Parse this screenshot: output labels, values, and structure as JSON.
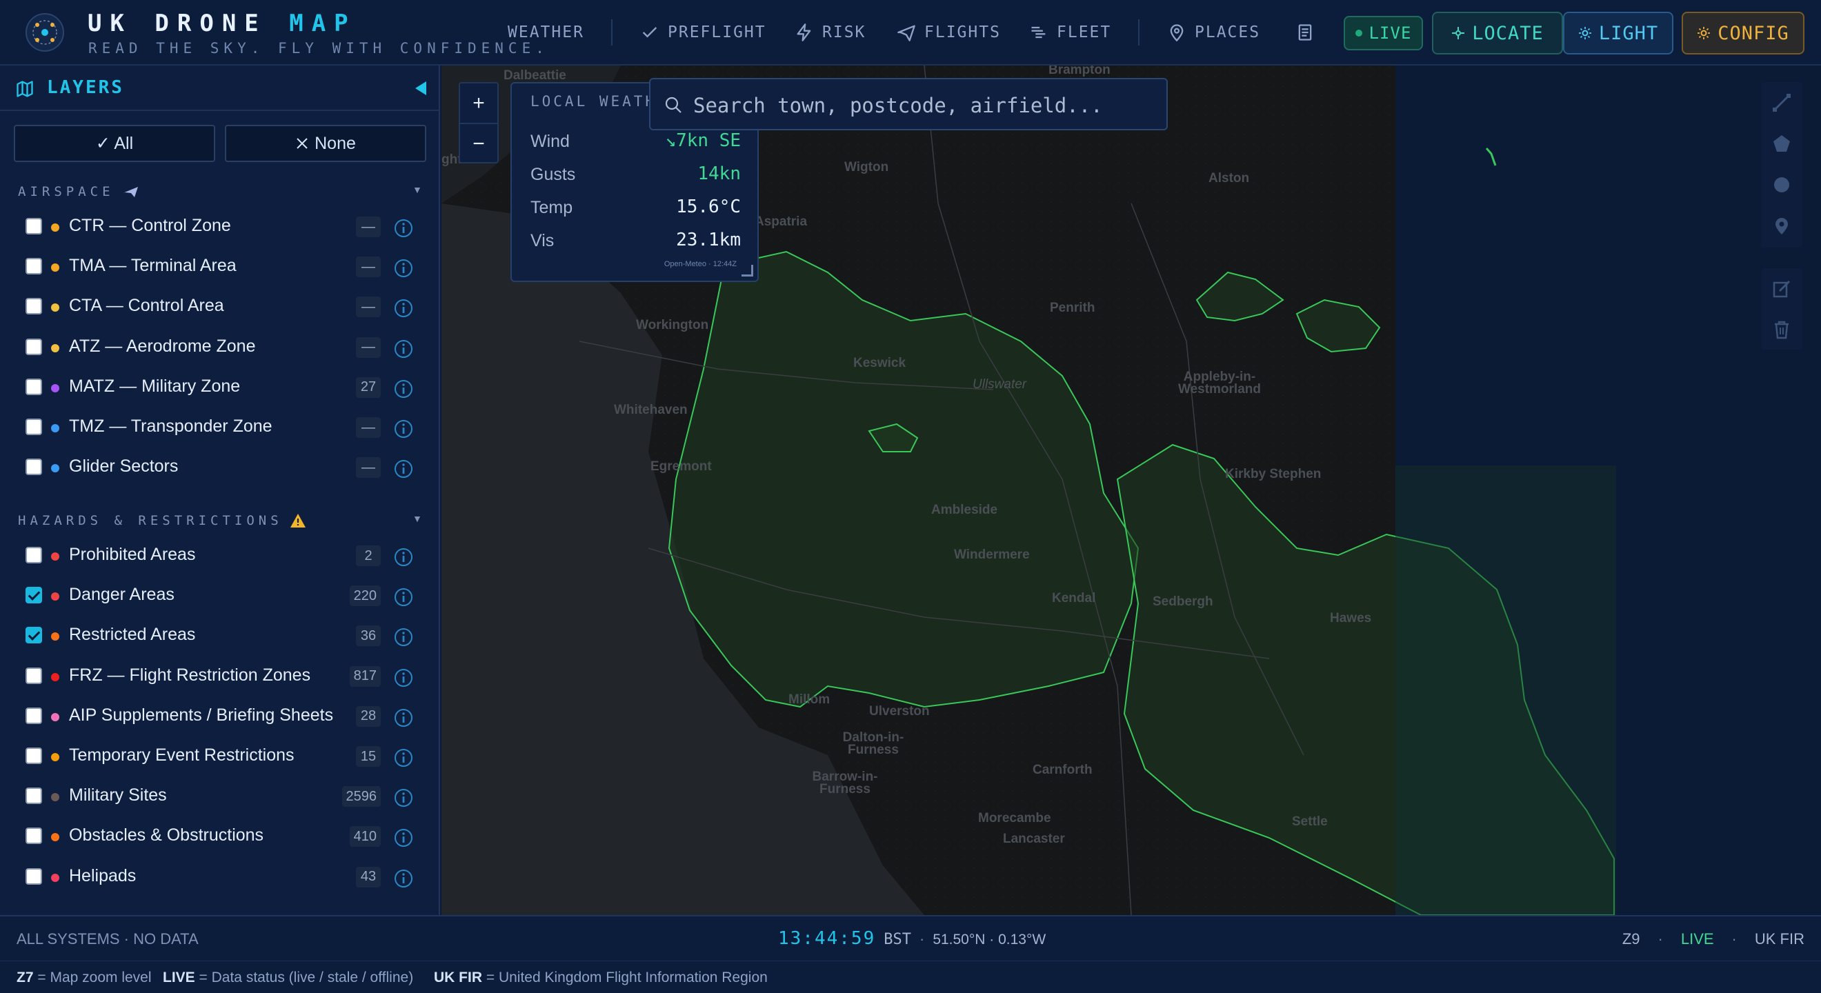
{
  "brand": {
    "title_main": "UK DRONE ",
    "title_accent": "MAP",
    "tagline": "READ THE SKY. FLY WITH CONFIDENCE."
  },
  "nav": [
    {
      "label": "WEATHER",
      "icon": "cloud-icon"
    },
    {
      "label": "PREFLIGHT",
      "icon": "check-icon"
    },
    {
      "label": "RISK",
      "icon": "lightning-icon"
    },
    {
      "label": "FLIGHTS",
      "icon": "plane-icon"
    },
    {
      "label": "FLEET",
      "icon": "drone-icon"
    },
    {
      "label": "PLACES",
      "icon": "pin-icon"
    }
  ],
  "topbar_buttons": {
    "live": "LIVE",
    "locate": "LOCATE",
    "light": "LIGHT",
    "config": "CONFIG"
  },
  "sidebar": {
    "title": "LAYERS",
    "all_label": "✓ All",
    "none_label": "None",
    "sections": [
      {
        "title": "AIRSPACE",
        "icon": "plane-icon",
        "layers": [
          {
            "name": "CTR — Control Zone",
            "color": "#f5a623",
            "count": "—",
            "checked": false
          },
          {
            "name": "TMA — Terminal Area",
            "color": "#f5a623",
            "count": "—",
            "checked": false
          },
          {
            "name": "CTA — Control Area",
            "color": "#f0c040",
            "count": "—",
            "checked": false
          },
          {
            "name": "ATZ — Aerodrome Zone",
            "color": "#f0c040",
            "count": "—",
            "checked": false
          },
          {
            "name": "MATZ — Military Zone",
            "color": "#a855f7",
            "count": "27",
            "checked": false
          },
          {
            "name": "TMZ — Transponder Zone",
            "color": "#3b9cf5",
            "count": "—",
            "checked": false
          },
          {
            "name": "Glider Sectors",
            "color": "#3b9cf5",
            "count": "—",
            "checked": false
          }
        ]
      },
      {
        "title": "HAZARDS & RESTRICTIONS",
        "icon": "warning-icon",
        "layers": [
          {
            "name": "Prohibited Areas",
            "color": "#ef4444",
            "count": "2",
            "checked": false
          },
          {
            "name": "Danger Areas",
            "color": "#ef4444",
            "count": "220",
            "checked": true
          },
          {
            "name": "Restricted Areas",
            "color": "#f97316",
            "count": "36",
            "checked": true
          },
          {
            "name": "FRZ — Flight Restriction Zones",
            "color": "#ef2020",
            "count": "817",
            "checked": false
          },
          {
            "name": "AIP Supplements / Briefing Sheets",
            "color": "#f472b6",
            "count": "28",
            "checked": false
          },
          {
            "name": "Temporary Event Restrictions",
            "color": "#f59e0b",
            "count": "15",
            "checked": false
          },
          {
            "name": "Military Sites",
            "color": "#6b5a55",
            "count": "2596",
            "checked": false
          },
          {
            "name": "Obstacles & Obstructions",
            "color": "#f97316",
            "count": "410",
            "checked": false
          },
          {
            "name": "Helipads",
            "color": "#f43f5e",
            "count": "43",
            "checked": false
          }
        ]
      }
    ]
  },
  "map": {
    "zoom_in": "+",
    "zoom_out": "−",
    "search_placeholder": "Search town, postcode, airfield...",
    "weather": {
      "title": "LOCAL WEATHER",
      "rows": [
        {
          "label": "Wind",
          "value": "↘7kn SE",
          "highlight": true
        },
        {
          "label": "Gusts",
          "value": "14kn",
          "highlight": true
        },
        {
          "label": "Temp",
          "value": "15.6°C",
          "highlight": false
        },
        {
          "label": "Vis",
          "value": "23.1km",
          "highlight": false
        }
      ],
      "source": "Open-Meteo · 12:44Z"
    },
    "places": [
      {
        "name": "Dalbeattie"
      },
      {
        "name": "Brampton"
      },
      {
        "name": "Wigton"
      },
      {
        "name": "Alston"
      },
      {
        "name": "Aspatria"
      },
      {
        "name": "Penrith"
      },
      {
        "name": "Workington"
      },
      {
        "name": "Keswick"
      },
      {
        "name": "Ullswater"
      },
      {
        "name": "Appleby-in-Westmorland"
      },
      {
        "name": "Whitehaven"
      },
      {
        "name": "Egremont"
      },
      {
        "name": "Kirkby Stephen"
      },
      {
        "name": "Ambleside"
      },
      {
        "name": "Windermere"
      },
      {
        "name": "Kendal"
      },
      {
        "name": "Sedbergh"
      },
      {
        "name": "Hawes"
      },
      {
        "name": "Millom"
      },
      {
        "name": "Ulverston"
      },
      {
        "name": "Dalton-in-Furness"
      },
      {
        "name": "Barrow-in-Furness"
      },
      {
        "name": "Carnforth"
      },
      {
        "name": "Morecambe"
      },
      {
        "name": "Lancaster"
      },
      {
        "name": "Settle"
      },
      {
        "name": "ght"
      }
    ]
  },
  "status": {
    "systems": "ALL SYSTEMS · NO DATA",
    "time": "13:44:59",
    "tz": "BST",
    "coords": "51.50°N · 0.13°W",
    "zoom": "Z9",
    "live": "LIVE",
    "fir": "UK FIR"
  },
  "legend": [
    {
      "key": "Z7",
      "desc": "= Map zoom level"
    },
    {
      "key": "LIVE",
      "desc": "= Data status (live / stale / offline)"
    },
    {
      "key": "UK FIR",
      "desc": "= United Kingdom Flight Information Region"
    }
  ]
}
